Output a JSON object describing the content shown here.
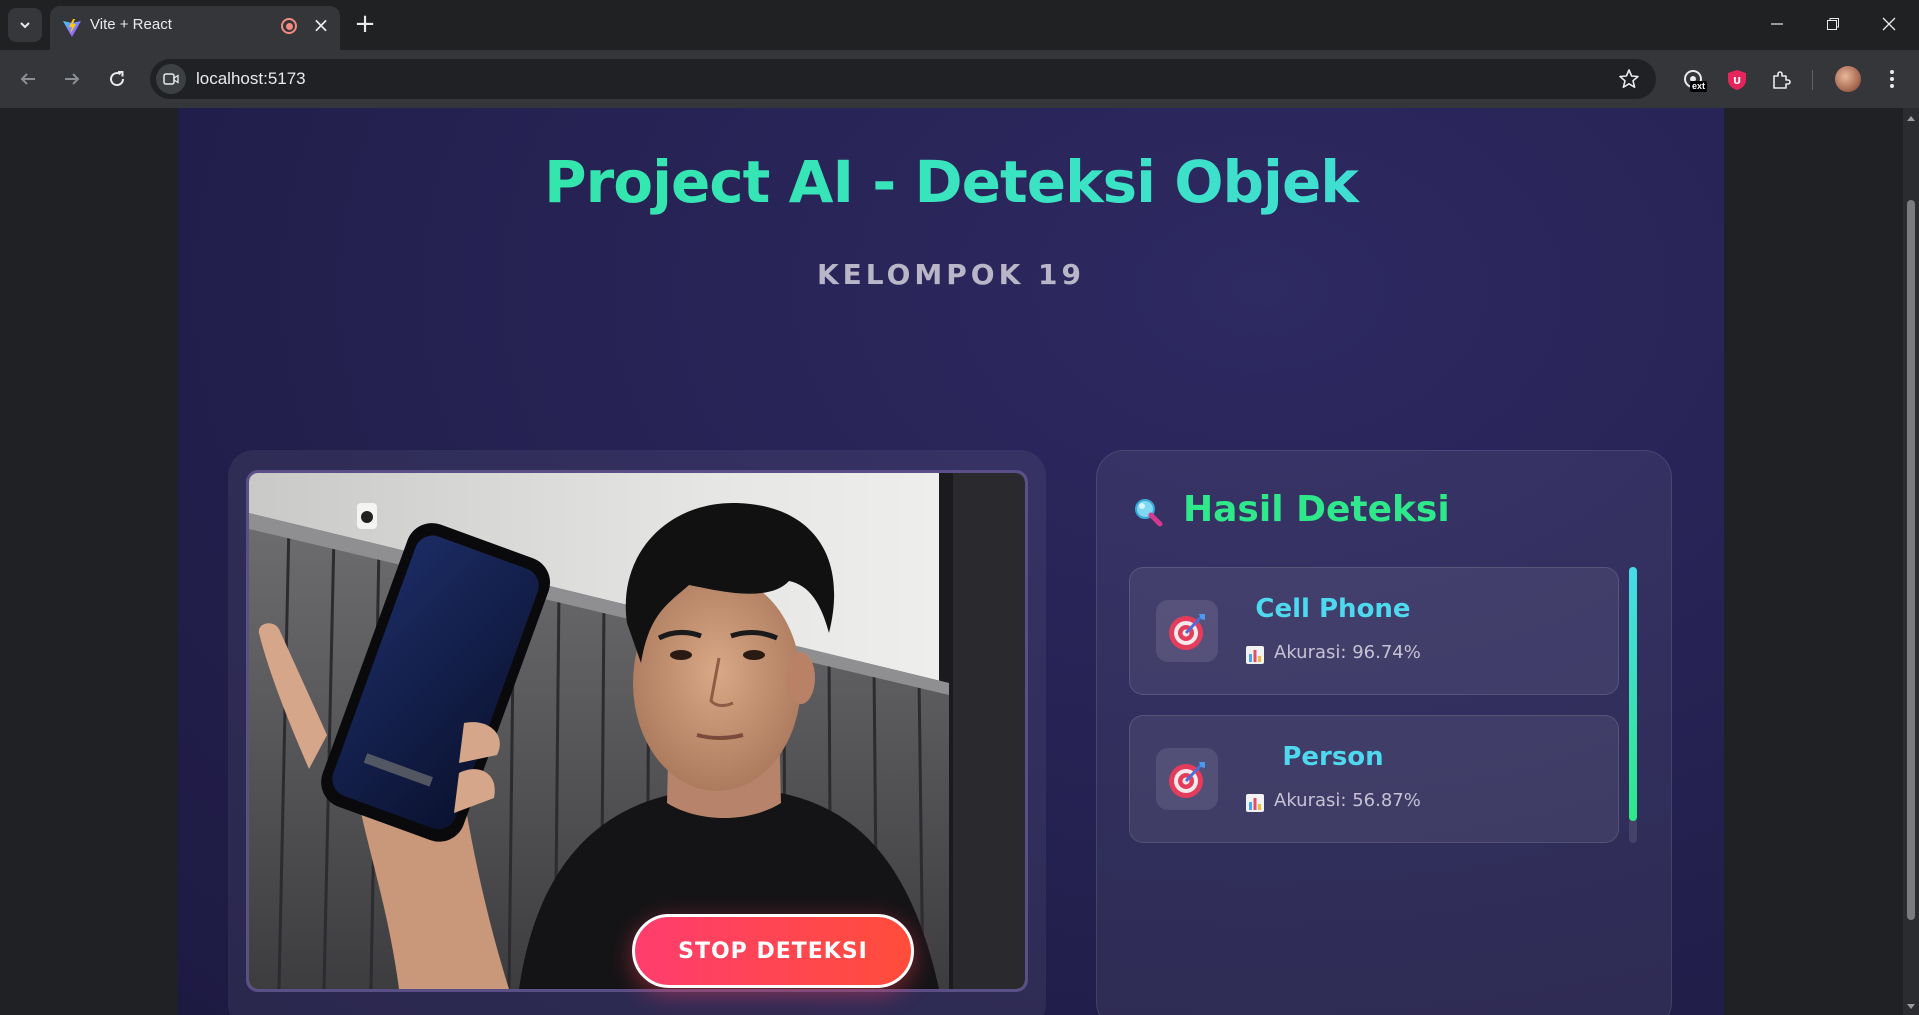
{
  "browser": {
    "tab_title": "Vite + React",
    "url": "localhost:5173",
    "extension_badge": "ext"
  },
  "app": {
    "title": "Project AI - Deteksi Objek",
    "subtitle": "KELOMPOK 19",
    "stop_button_label": "STOP DETEKSI",
    "results_title": "Hasil Deteksi",
    "results": [
      {
        "name": "Cell Phone",
        "accuracy": "Akurasi: 96.74%"
      },
      {
        "name": "Person",
        "accuracy": "Akurasi: 56.87%"
      }
    ]
  },
  "icons": {
    "results_header": "magnifier-icon",
    "result_item": "target-icon",
    "accuracy": "bar-chart-icon"
  },
  "colors": {
    "accent_green": "#2ee88a",
    "accent_cyan": "#4ed9ef",
    "stop_red": "#ff3d6e",
    "app_background": "#272355"
  }
}
